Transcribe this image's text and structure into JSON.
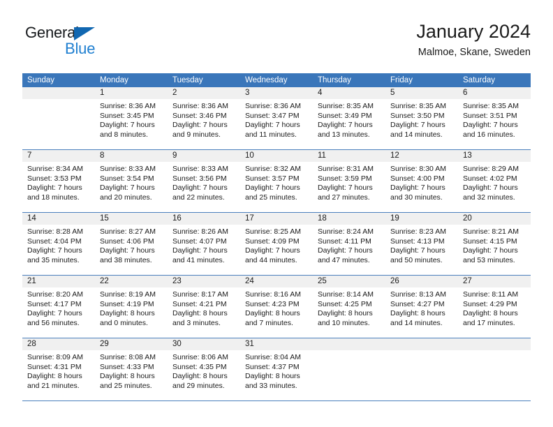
{
  "brand": {
    "name_top": "General",
    "name_bottom": "Blue",
    "triangle_color": "#1167b1",
    "blue_text_color": "#1f7fd0"
  },
  "header": {
    "title": "January 2024",
    "subtitle": "Malmoe, Skane, Sweden"
  },
  "theme": {
    "header_bg": "#3a76ba",
    "header_text": "#ffffff",
    "daynum_bg": "#f0f0f0",
    "row_divider": "#4a7fbd",
    "body_text": "#1a1a1a"
  },
  "weekdays": [
    "Sunday",
    "Monday",
    "Tuesday",
    "Wednesday",
    "Thursday",
    "Friday",
    "Saturday"
  ],
  "weeks": [
    [
      {
        "day": "",
        "lines": []
      },
      {
        "day": "1",
        "lines": [
          "Sunrise: 8:36 AM",
          "Sunset: 3:45 PM",
          "Daylight: 7 hours",
          "and 8 minutes."
        ]
      },
      {
        "day": "2",
        "lines": [
          "Sunrise: 8:36 AM",
          "Sunset: 3:46 PM",
          "Daylight: 7 hours",
          "and 9 minutes."
        ]
      },
      {
        "day": "3",
        "lines": [
          "Sunrise: 8:36 AM",
          "Sunset: 3:47 PM",
          "Daylight: 7 hours",
          "and 11 minutes."
        ]
      },
      {
        "day": "4",
        "lines": [
          "Sunrise: 8:35 AM",
          "Sunset: 3:49 PM",
          "Daylight: 7 hours",
          "and 13 minutes."
        ]
      },
      {
        "day": "5",
        "lines": [
          "Sunrise: 8:35 AM",
          "Sunset: 3:50 PM",
          "Daylight: 7 hours",
          "and 14 minutes."
        ]
      },
      {
        "day": "6",
        "lines": [
          "Sunrise: 8:35 AM",
          "Sunset: 3:51 PM",
          "Daylight: 7 hours",
          "and 16 minutes."
        ]
      }
    ],
    [
      {
        "day": "7",
        "lines": [
          "Sunrise: 8:34 AM",
          "Sunset: 3:53 PM",
          "Daylight: 7 hours",
          "and 18 minutes."
        ]
      },
      {
        "day": "8",
        "lines": [
          "Sunrise: 8:33 AM",
          "Sunset: 3:54 PM",
          "Daylight: 7 hours",
          "and 20 minutes."
        ]
      },
      {
        "day": "9",
        "lines": [
          "Sunrise: 8:33 AM",
          "Sunset: 3:56 PM",
          "Daylight: 7 hours",
          "and 22 minutes."
        ]
      },
      {
        "day": "10",
        "lines": [
          "Sunrise: 8:32 AM",
          "Sunset: 3:57 PM",
          "Daylight: 7 hours",
          "and 25 minutes."
        ]
      },
      {
        "day": "11",
        "lines": [
          "Sunrise: 8:31 AM",
          "Sunset: 3:59 PM",
          "Daylight: 7 hours",
          "and 27 minutes."
        ]
      },
      {
        "day": "12",
        "lines": [
          "Sunrise: 8:30 AM",
          "Sunset: 4:00 PM",
          "Daylight: 7 hours",
          "and 30 minutes."
        ]
      },
      {
        "day": "13",
        "lines": [
          "Sunrise: 8:29 AM",
          "Sunset: 4:02 PM",
          "Daylight: 7 hours",
          "and 32 minutes."
        ]
      }
    ],
    [
      {
        "day": "14",
        "lines": [
          "Sunrise: 8:28 AM",
          "Sunset: 4:04 PM",
          "Daylight: 7 hours",
          "and 35 minutes."
        ]
      },
      {
        "day": "15",
        "lines": [
          "Sunrise: 8:27 AM",
          "Sunset: 4:06 PM",
          "Daylight: 7 hours",
          "and 38 minutes."
        ]
      },
      {
        "day": "16",
        "lines": [
          "Sunrise: 8:26 AM",
          "Sunset: 4:07 PM",
          "Daylight: 7 hours",
          "and 41 minutes."
        ]
      },
      {
        "day": "17",
        "lines": [
          "Sunrise: 8:25 AM",
          "Sunset: 4:09 PM",
          "Daylight: 7 hours",
          "and 44 minutes."
        ]
      },
      {
        "day": "18",
        "lines": [
          "Sunrise: 8:24 AM",
          "Sunset: 4:11 PM",
          "Daylight: 7 hours",
          "and 47 minutes."
        ]
      },
      {
        "day": "19",
        "lines": [
          "Sunrise: 8:23 AM",
          "Sunset: 4:13 PM",
          "Daylight: 7 hours",
          "and 50 minutes."
        ]
      },
      {
        "day": "20",
        "lines": [
          "Sunrise: 8:21 AM",
          "Sunset: 4:15 PM",
          "Daylight: 7 hours",
          "and 53 minutes."
        ]
      }
    ],
    [
      {
        "day": "21",
        "lines": [
          "Sunrise: 8:20 AM",
          "Sunset: 4:17 PM",
          "Daylight: 7 hours",
          "and 56 minutes."
        ]
      },
      {
        "day": "22",
        "lines": [
          "Sunrise: 8:19 AM",
          "Sunset: 4:19 PM",
          "Daylight: 8 hours",
          "and 0 minutes."
        ]
      },
      {
        "day": "23",
        "lines": [
          "Sunrise: 8:17 AM",
          "Sunset: 4:21 PM",
          "Daylight: 8 hours",
          "and 3 minutes."
        ]
      },
      {
        "day": "24",
        "lines": [
          "Sunrise: 8:16 AM",
          "Sunset: 4:23 PM",
          "Daylight: 8 hours",
          "and 7 minutes."
        ]
      },
      {
        "day": "25",
        "lines": [
          "Sunrise: 8:14 AM",
          "Sunset: 4:25 PM",
          "Daylight: 8 hours",
          "and 10 minutes."
        ]
      },
      {
        "day": "26",
        "lines": [
          "Sunrise: 8:13 AM",
          "Sunset: 4:27 PM",
          "Daylight: 8 hours",
          "and 14 minutes."
        ]
      },
      {
        "day": "27",
        "lines": [
          "Sunrise: 8:11 AM",
          "Sunset: 4:29 PM",
          "Daylight: 8 hours",
          "and 17 minutes."
        ]
      }
    ],
    [
      {
        "day": "28",
        "lines": [
          "Sunrise: 8:09 AM",
          "Sunset: 4:31 PM",
          "Daylight: 8 hours",
          "and 21 minutes."
        ]
      },
      {
        "day": "29",
        "lines": [
          "Sunrise: 8:08 AM",
          "Sunset: 4:33 PM",
          "Daylight: 8 hours",
          "and 25 minutes."
        ]
      },
      {
        "day": "30",
        "lines": [
          "Sunrise: 8:06 AM",
          "Sunset: 4:35 PM",
          "Daylight: 8 hours",
          "and 29 minutes."
        ]
      },
      {
        "day": "31",
        "lines": [
          "Sunrise: 8:04 AM",
          "Sunset: 4:37 PM",
          "Daylight: 8 hours",
          "and 33 minutes."
        ]
      },
      {
        "day": "",
        "lines": []
      },
      {
        "day": "",
        "lines": []
      },
      {
        "day": "",
        "lines": []
      }
    ]
  ]
}
